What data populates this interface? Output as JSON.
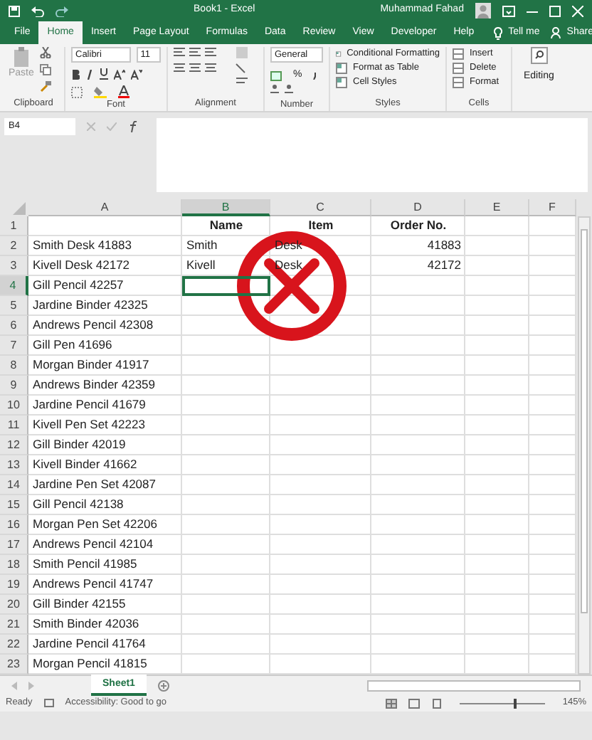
{
  "window": {
    "title": "Book1  -  Excel",
    "user": "Muhammad Fahad"
  },
  "tabs": [
    {
      "label": "File",
      "selected": false
    },
    {
      "label": "Home",
      "selected": true
    },
    {
      "label": "Insert",
      "selected": false
    },
    {
      "label": "Page Layout",
      "selected": false
    },
    {
      "label": "Formulas",
      "selected": false
    },
    {
      "label": "Data",
      "selected": false
    },
    {
      "label": "Review",
      "selected": false
    },
    {
      "label": "View",
      "selected": false
    },
    {
      "label": "Developer",
      "selected": false
    },
    {
      "label": "Help",
      "selected": false
    }
  ],
  "tell_me": "Tell me",
  "share": "Share",
  "ribbon": {
    "paste": "Paste",
    "font_name": "Calibri",
    "font_size": "11",
    "number_format": "General",
    "percent": "%",
    "styles": [
      "Conditional Formatting",
      "Format as Table",
      "Cell Styles"
    ],
    "cells": [
      "Insert",
      "Delete",
      "Format"
    ],
    "editing": "Editing",
    "groups": [
      "Clipboard",
      "Font",
      "Alignment",
      "Number",
      "Styles",
      "Cells"
    ]
  },
  "name_box": "B4",
  "columns": [
    {
      "label": "A",
      "selected": false
    },
    {
      "label": "B",
      "selected": true
    },
    {
      "label": "C",
      "selected": false
    },
    {
      "label": "D",
      "selected": false
    },
    {
      "label": "E",
      "selected": false
    },
    {
      "label": "F",
      "selected": false
    }
  ],
  "rows": [
    {
      "number": "1",
      "selected": false,
      "cells": [
        "",
        "Name",
        "Item",
        "Order No."
      ]
    },
    {
      "number": "2",
      "selected": false,
      "cells": [
        "Smith Desk 41883",
        "Smith",
        "Desk",
        "41883"
      ]
    },
    {
      "number": "3",
      "selected": false,
      "cells": [
        "Kivell Desk 42172",
        "Kivell",
        "Desk",
        "42172"
      ]
    },
    {
      "number": "4",
      "selected": true,
      "cells": [
        "Gill Pencil 42257",
        "",
        "",
        ""
      ]
    },
    {
      "number": "5",
      "selected": false,
      "cells": [
        "Jardine Binder 42325",
        "",
        "",
        ""
      ]
    },
    {
      "number": "6",
      "selected": false,
      "cells": [
        "Andrews Pencil 42308",
        "",
        "",
        ""
      ]
    },
    {
      "number": "7",
      "selected": false,
      "cells": [
        "Gill Pen 41696",
        "",
        "",
        ""
      ]
    },
    {
      "number": "8",
      "selected": false,
      "cells": [
        "Morgan Binder 41917",
        "",
        "",
        ""
      ]
    },
    {
      "number": "9",
      "selected": false,
      "cells": [
        "Andrews Binder 42359",
        "",
        "",
        ""
      ]
    },
    {
      "number": "10",
      "selected": false,
      "cells": [
        "Jardine Pencil 41679",
        "",
        "",
        ""
      ]
    },
    {
      "number": "11",
      "selected": false,
      "cells": [
        "Kivell Pen Set 42223",
        "",
        "",
        ""
      ]
    },
    {
      "number": "12",
      "selected": false,
      "cells": [
        "Gill Binder 42019",
        "",
        "",
        ""
      ]
    },
    {
      "number": "13",
      "selected": false,
      "cells": [
        "Kivell Binder 41662",
        "",
        "",
        ""
      ]
    },
    {
      "number": "14",
      "selected": false,
      "cells": [
        "Jardine Pen Set 42087",
        "",
        "",
        ""
      ]
    },
    {
      "number": "15",
      "selected": false,
      "cells": [
        "Gill Pencil 42138",
        "",
        "",
        ""
      ]
    },
    {
      "number": "16",
      "selected": false,
      "cells": [
        "Morgan Pen Set 42206",
        "",
        "",
        ""
      ]
    },
    {
      "number": "17",
      "selected": false,
      "cells": [
        "Andrews Pencil 42104",
        "",
        "",
        ""
      ]
    },
    {
      "number": "18",
      "selected": false,
      "cells": [
        "Smith Pencil 41985",
        "",
        "",
        ""
      ]
    },
    {
      "number": "19",
      "selected": false,
      "cells": [
        "Andrews Pencil 41747",
        "",
        "",
        ""
      ]
    },
    {
      "number": "20",
      "selected": false,
      "cells": [
        "Gill Binder 42155",
        "",
        "",
        ""
      ]
    },
    {
      "number": "21",
      "selected": false,
      "cells": [
        "Smith Binder 42036",
        "",
        "",
        ""
      ]
    },
    {
      "number": "22",
      "selected": false,
      "cells": [
        "Jardine Pencil 41764",
        "",
        "",
        ""
      ]
    },
    {
      "number": "23",
      "selected": false,
      "cells": [
        "Morgan Pencil 41815",
        "",
        "",
        ""
      ]
    }
  ],
  "sheet_tabs": [
    {
      "label": "Sheet1",
      "selected": true
    }
  ],
  "status_bar": {
    "status": "Ready",
    "accessibility": "Accessibility: Good to go",
    "zoom": "145%",
    "zoom_slider": {
      "level": 0.62
    }
  }
}
